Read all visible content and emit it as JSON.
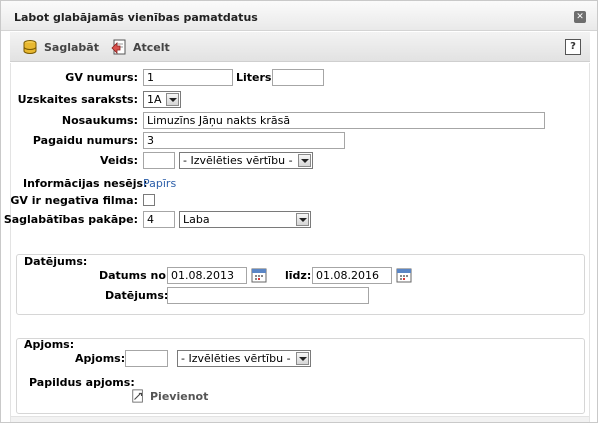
{
  "window": {
    "title": "Labot glabājamās vienības pamatdatus"
  },
  "toolbar": {
    "save_label": "Saglabāt",
    "cancel_label": "Atcelt",
    "help_label": "?"
  },
  "form": {
    "gv_numurs_label": "GV numurs:",
    "gv_numurs_value": "1",
    "liters_label": "Liters:",
    "liters_value": "",
    "uzskaites_label": "Uzskaites saraksts:",
    "uzskaites_value": "1A",
    "nosaukums_label": "Nosaukums:",
    "nosaukums_value": "Limuzīns Jāņu nakts krāsā",
    "pagaidu_label": "Pagaidu numurs:",
    "pagaidu_value": "3",
    "veids_label": "Veids:",
    "veids_value": "",
    "veids_select": "- Izvēlēties vērtību -",
    "nesejs_label": "Informācijas nesējs:",
    "nesejs_value": "Papīrs",
    "negativa_label": "GV ir negatīva filma:",
    "pakape_label": "Saglabātības pakāpe:",
    "pakape_value": "4",
    "pakape_select": "Laba"
  },
  "datejums": {
    "legend": "Datējums:",
    "datums_no_label": "Datums no:",
    "datums_no_value": "01.08.2013",
    "lidz_label": "līdz:",
    "lidz_value": "01.08.2016",
    "datejums_label": "Datējums:",
    "datejums_value": ""
  },
  "apjoms": {
    "legend": "Apjoms:",
    "apjoms_label": "Apjoms:",
    "apjoms_value": "",
    "apjoms_select": "- Izvēlēties vērtību -",
    "papildus_label": "Papildus apjoms:",
    "add_label": "Pievienot"
  }
}
